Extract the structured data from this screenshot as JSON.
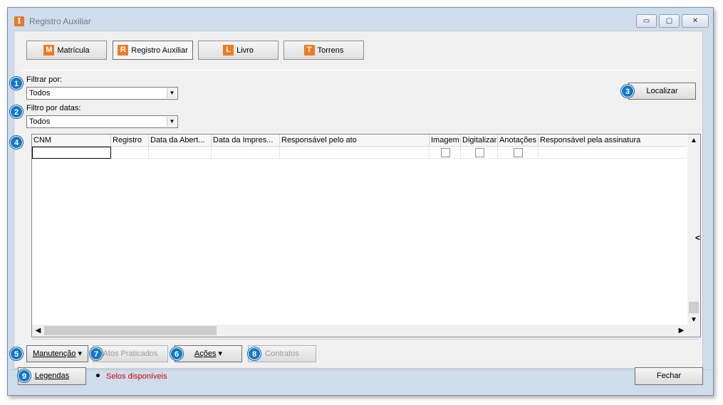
{
  "window": {
    "title": "Registro Auxiliar",
    "app_icon_letter": "I",
    "controls": {
      "minimize": "▭",
      "maximize": "▢",
      "close": "✕"
    }
  },
  "tabs": [
    {
      "letter": "M",
      "label": "Matrícula"
    },
    {
      "letter": "R",
      "label": "Registro Auxiliar"
    },
    {
      "letter": "L",
      "label": "Livro"
    },
    {
      "letter": "T",
      "label": "Torrens"
    }
  ],
  "filters": {
    "filtrar_label": "Filtrar por:",
    "filtrar_value": "Todos",
    "datas_label": "Filtro por datas:",
    "datas_value": "Todos",
    "localizar_label": "Localizar"
  },
  "badges": [
    "1",
    "2",
    "3",
    "4",
    "5",
    "6",
    "7",
    "8",
    "9"
  ],
  "grid": {
    "columns": [
      "CNM",
      "Registro",
      "Data da Abert...",
      "Data da Impres...",
      "Responsável pelo ato",
      "Imagem",
      "Digitalizar",
      "Anotações",
      "Responsável pela assinatura"
    ],
    "collapse_glyph": "<"
  },
  "actions": {
    "manutencao": "Manutenção",
    "atos": "Atos Praticados",
    "acoes": "Ações",
    "contratos": "Contratos"
  },
  "footer": {
    "legendas": "Legendas",
    "selos": "Selos disponíveis",
    "fechar": "Fechar"
  },
  "colors": {
    "accent_orange": "#ef7b24",
    "badge_blue": "#1478c8",
    "selos_red": "#d00000"
  }
}
